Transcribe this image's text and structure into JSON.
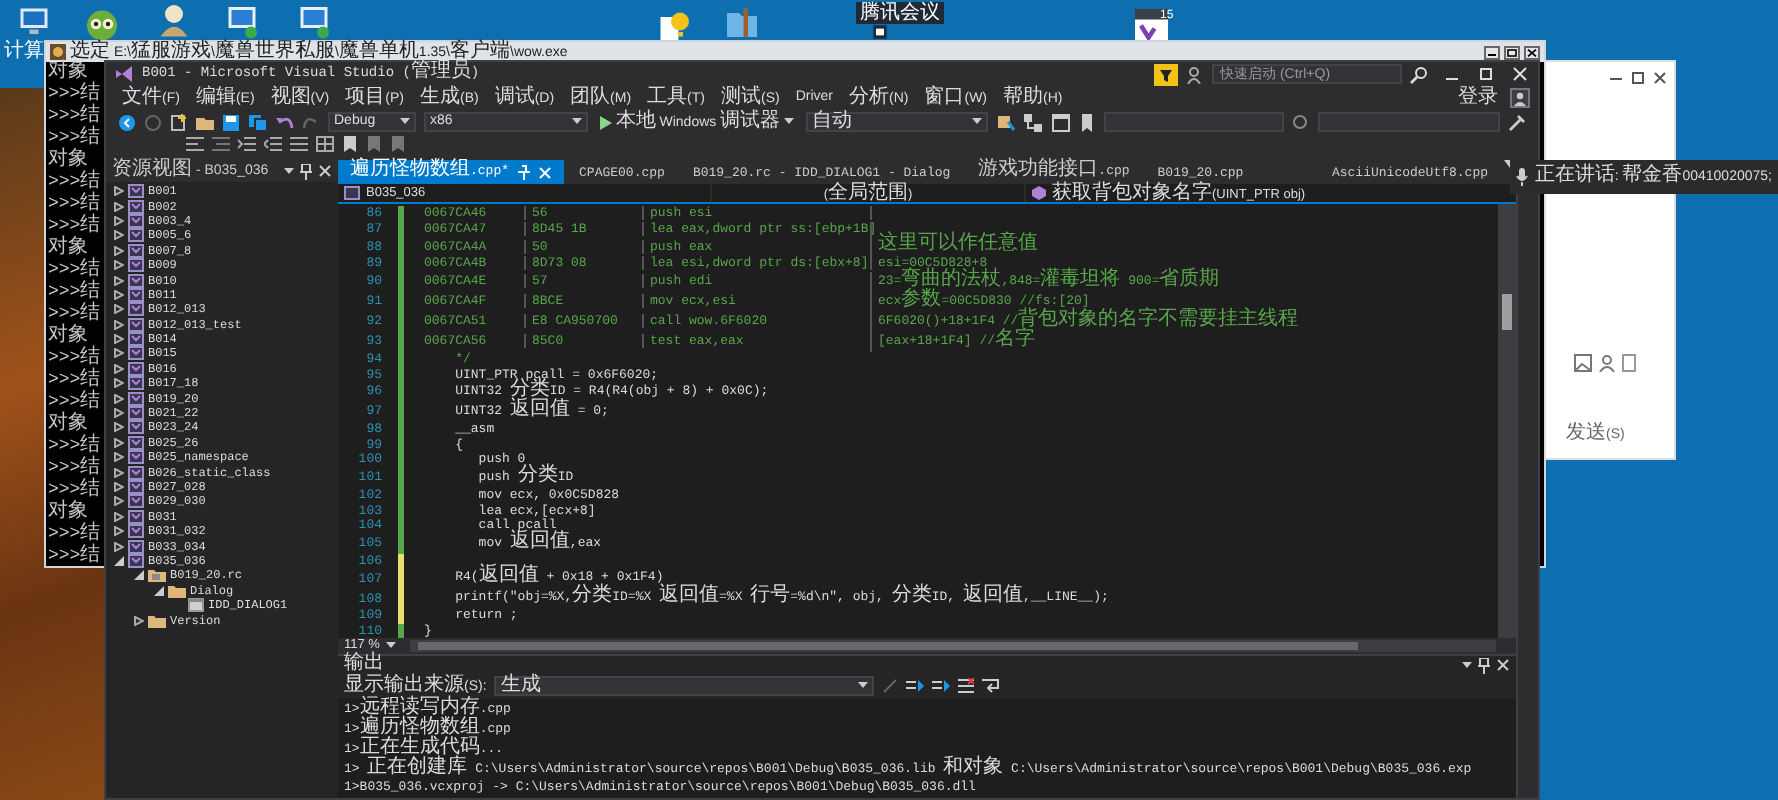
{
  "desktop": {
    "icons": [
      {
        "kind": "computer",
        "label": "计算"
      },
      {
        "kind": "monster"
      },
      {
        "kind": "person"
      },
      {
        "kind": "monitor"
      },
      {
        "kind": "monitor"
      },
      {
        "kind": "help"
      },
      {
        "kind": "folder"
      },
      {
        "kind": "meeting",
        "label": "腾讯会议"
      },
      {
        "kind": "calendar",
        "label": "15"
      }
    ]
  },
  "console": {
    "title": "选定 E:\\猛服游戏\\魔兽世界私服\\魔兽单机1.35\\客户端\\wow.exe",
    "lines": [
      "对象",
      ">>>结",
      ">>>结",
      ">>>结",
      "对象",
      ">>>结",
      ">>>结",
      ">>>结",
      "对象",
      ">>>结",
      ">>>结",
      ">>>结",
      "对象",
      ">>>结",
      ">>>结",
      ">>>结",
      "对象",
      ">>>结",
      ">>>结",
      ">>>结",
      "对象",
      ">>>结",
      ">>>结"
    ]
  },
  "vs": {
    "title": "B001 - Microsoft Visual Studio (管理员)",
    "quick_launch": {
      "placeholder": "快速启动 (Ctrl+Q)"
    },
    "menu": [
      "文件(F)",
      "编辑(E)",
      "视图(V)",
      "项目(P)",
      "生成(B)",
      "调试(D)",
      "团队(M)",
      "工具(T)",
      "测试(S)",
      "Driver",
      "分析(N)",
      "窗口(W)",
      "帮助(H)"
    ],
    "sign_in": "登录",
    "toolbar": {
      "configuration": "Debug",
      "platform": "x86",
      "run": "本地 Windows 调试器",
      "run_mode": "自动"
    },
    "resource_view": {
      "title": "资源视图 - B035_036",
      "tree": [
        {
          "label": "B001",
          "kind": "project",
          "expanded": false
        },
        {
          "label": "B002",
          "kind": "project",
          "expanded": false
        },
        {
          "label": "B003_4",
          "kind": "project",
          "expanded": false
        },
        {
          "label": "B005_6",
          "kind": "project",
          "expanded": false
        },
        {
          "label": "B007_8",
          "kind": "project",
          "expanded": false
        },
        {
          "label": "B009",
          "kind": "project",
          "expanded": false
        },
        {
          "label": "B010",
          "kind": "project",
          "expanded": false
        },
        {
          "label": "B011",
          "kind": "project",
          "expanded": false
        },
        {
          "label": "B012_013",
          "kind": "project",
          "expanded": false
        },
        {
          "label": "B012_013_test",
          "kind": "project",
          "expanded": false
        },
        {
          "label": "B014",
          "kind": "project",
          "expanded": false
        },
        {
          "label": "B015",
          "kind": "project",
          "expanded": false
        },
        {
          "label": "B016",
          "kind": "project",
          "expanded": false
        },
        {
          "label": "B017_18",
          "kind": "project",
          "expanded": false
        },
        {
          "label": "B019_20",
          "kind": "project",
          "expanded": false
        },
        {
          "label": "B021_22",
          "kind": "project",
          "expanded": false
        },
        {
          "label": "B023_24",
          "kind": "project",
          "expanded": false
        },
        {
          "label": "B025_26",
          "kind": "project",
          "expanded": false
        },
        {
          "label": "B025_namespace",
          "kind": "project",
          "expanded": false
        },
        {
          "label": "B026_static_class",
          "kind": "project",
          "expanded": false
        },
        {
          "label": "B027_028",
          "kind": "project",
          "expanded": false
        },
        {
          "label": "B029_030",
          "kind": "project",
          "expanded": false
        },
        {
          "label": "B031",
          "kind": "project",
          "expanded": false
        },
        {
          "label": "B031_032",
          "kind": "project",
          "expanded": false
        },
        {
          "label": "B033_034",
          "kind": "project",
          "expanded": false
        },
        {
          "label": "B035_036",
          "kind": "project",
          "expanded": true,
          "children": [
            {
              "label": "B019_20.rc",
              "kind": "resource",
              "expanded": true,
              "children": [
                {
                  "label": "Dialog",
                  "kind": "folder",
                  "expanded": true,
                  "children": [
                    {
                      "label": "IDD_DIALOG1",
                      "kind": "dialog"
                    }
                  ]
                }
              ]
            },
            {
              "label": "Version",
              "kind": "folder",
              "expanded": false
            }
          ]
        }
      ]
    },
    "tabs": [
      {
        "label": "遍历怪物数组.cpp*",
        "selected": true
      },
      {
        "label": "CPAGE00.cpp",
        "selected": false
      },
      {
        "label": "B019_20.rc - IDD_DIALOG1 - Dialog",
        "selected": false
      },
      {
        "label": "游戏功能接口.cpp",
        "selected": false
      },
      {
        "label": "B019_20.cpp",
        "selected": false
      },
      {
        "label": "AsciiUnicodeUtf8.cpp",
        "selected": false
      }
    ],
    "nav": {
      "project": "B035_036",
      "scope": "(全局范围)",
      "member": "获取背包对象名字(UINT_PTR obj)"
    },
    "code": [
      {
        "number": "86",
        "kind": "asm",
        "color": "#57a64a",
        "address": "0067CA46",
        "bytes": "56",
        "instruction": "push esi"
      },
      {
        "number": "87",
        "kind": "asm",
        "color": "#57a64a",
        "address": "0067CA47",
        "bytes": "8D45 1B",
        "instruction": "lea eax,dword ptr ss:[ebp+1B]"
      },
      {
        "number": "88",
        "kind": "asm",
        "color": "#57a64a",
        "address": "0067CA4A",
        "bytes": "50",
        "instruction": "push eax",
        "comment": "这里可以作任意值"
      },
      {
        "number": "89",
        "kind": "asm",
        "color": "#57a64a",
        "address": "0067CA4B",
        "bytes": "8D73 08",
        "instruction": "lea esi,dword ptr ds:[ebx+8]",
        "comment": "esi=00C5D828+8"
      },
      {
        "number": "90",
        "kind": "asm",
        "color": "#57a64a",
        "address": "0067CA4E",
        "bytes": "57",
        "instruction": "push edi",
        "comment": "23=弯曲的法杖,848=灌毒坦将 900=省质期"
      },
      {
        "number": "91",
        "kind": "asm",
        "color": "#57a64a",
        "address": "0067CA4F",
        "bytes": "8BCE",
        "instruction": "mov ecx,esi",
        "comment": "ecx参数=00C5D830 //fs:[20]"
      },
      {
        "number": "92",
        "kind": "asm",
        "color": "#57a64a",
        "address": "0067CA51",
        "bytes": "E8 CA950700",
        "instruction": "call wow.6F6020",
        "comment": "6F6020()+18+1F4 //背包对象的名字 不需要挂主线程"
      },
      {
        "number": "93",
        "kind": "asm",
        "color": "#57a64a",
        "address": "0067CA56",
        "bytes": "85C0",
        "instruction": "test eax,eax",
        "comment": "[eax+18+1F4] //名字"
      },
      {
        "number": "94",
        "kind": "comment",
        "color": "#57a64a",
        "text": "    */"
      },
      {
        "number": "95",
        "kind": "code",
        "color": "#57a64a",
        "text": "    UINT_PTR pcall = 0x6F6020;"
      },
      {
        "number": "96",
        "kind": "code",
        "color": "#57a64a",
        "text": "    UINT32 分类ID = R4(R4(obj + 8) + 0x0C);"
      },
      {
        "number": "97",
        "kind": "code",
        "color": "#57a64a",
        "text": "    UINT32 返回值 = 0;"
      },
      {
        "number": "98",
        "kind": "code",
        "color": "#57a64a",
        "text": "    __asm"
      },
      {
        "number": "99",
        "kind": "code",
        "color": "#57a64a",
        "text": "    {"
      },
      {
        "number": "100",
        "kind": "code",
        "color": "#57a64a",
        "text": "       push 0"
      },
      {
        "number": "101",
        "kind": "code",
        "color": "#57a64a",
        "text": "       push 分类ID"
      },
      {
        "number": "102",
        "kind": "code",
        "color": "#57a64a",
        "text": "       mov ecx, 0x0C5D828"
      },
      {
        "number": "103",
        "kind": "code",
        "color": "#57a64a",
        "text": "       lea ecx,[ecx+8]"
      },
      {
        "number": "104",
        "kind": "code",
        "color": "#57a64a",
        "text": "       call pcall"
      },
      {
        "number": "105",
        "kind": "code",
        "color": "#57a64a",
        "text": "       mov 返回值,eax"
      },
      {
        "number": "106",
        "kind": "code",
        "color": "#e8e06a"
      },
      {
        "number": "107",
        "kind": "code",
        "color": "#e8e06a",
        "text": "    R4(返回值 + 0x18 + 0x1F4)"
      },
      {
        "number": "108",
        "kind": "code",
        "color": "#e8e06a",
        "text": "    printf(\"obj=%X,分类ID=%X 返回值=%X 行号=%d\\n\", obj, 分类ID, 返回值,__LINE__);"
      },
      {
        "number": "109",
        "kind": "code",
        "color": "#e8e06a",
        "text": "    return ;"
      },
      {
        "number": "110",
        "kind": "code",
        "color": "#57a64a",
        "text": "}"
      }
    ],
    "zoom": "117 %",
    "output": {
      "title": "输出",
      "source_label": "显示输出来源(S):",
      "source": "生成",
      "lines": [
        "1>远程读写内存.cpp",
        "1>遍历怪物数组.cpp",
        "1>正在生成代码...",
        "1>   正在创建库 C:\\Users\\Administrator\\source\\repos\\B001\\Debug\\B035_036.lib 和对象 C:\\Users\\Administrator\\source\\repos\\B001\\Debug\\B035_036.exp",
        "1>B035_036.vcxproj -> C:\\Users\\Administrator\\source\\repos\\B001\\Debug\\B035_036.dll"
      ]
    }
  },
  "chat_window": {
    "send_button": "发送(S)"
  },
  "notification": {
    "text": "正在讲话: 帮金香00410020075;"
  }
}
